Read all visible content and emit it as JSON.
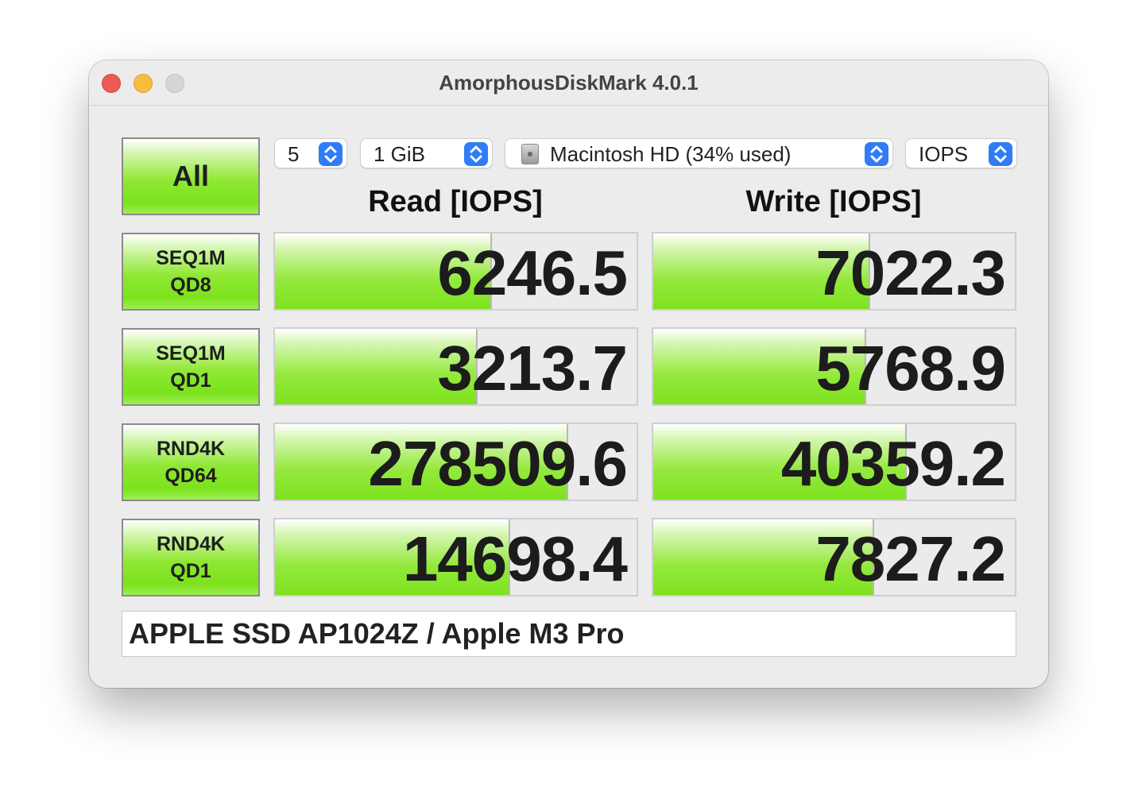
{
  "window": {
    "title": "AmorphousDiskMark 4.0.1"
  },
  "controls": {
    "all_label": "All",
    "count": "5",
    "size": "1 GiB",
    "disk": "Macintosh HD (34% used)",
    "unit": "IOPS"
  },
  "headers": {
    "read": "Read [IOPS]",
    "write": "Write [IOPS]"
  },
  "tests": [
    {
      "line1": "SEQ1M",
      "line2": "QD8",
      "read": "6246.5",
      "write": "7022.3",
      "read_fill": 0.6,
      "write_fill": 0.6
    },
    {
      "line1": "SEQ1M",
      "line2": "QD1",
      "read": "3213.7",
      "write": "5768.9",
      "read_fill": 0.56,
      "write_fill": 0.59
    },
    {
      "line1": "RND4K",
      "line2": "QD64",
      "read": "278509.6",
      "write": "40359.2",
      "read_fill": 0.81,
      "write_fill": 0.7
    },
    {
      "line1": "RND4K",
      "line2": "QD1",
      "read": "14698.4",
      "write": "7827.2",
      "read_fill": 0.65,
      "write_fill": 0.61
    }
  ],
  "device": "APPLE SSD AP1024Z / Apple M3 Pro",
  "colors": {
    "accent_green": "#7ce21c",
    "stepper_blue": "#2f7cf6",
    "close": "#ee5b54",
    "minimize": "#f5be3c"
  }
}
